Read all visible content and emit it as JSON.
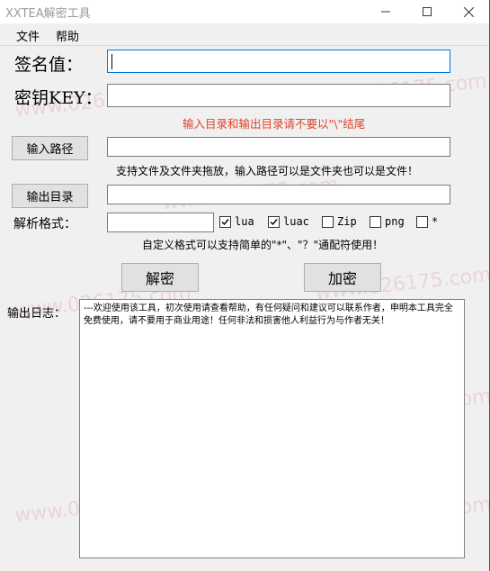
{
  "window": {
    "title": "XXTEA解密工具",
    "controls": [
      "minimize",
      "maximize",
      "close"
    ]
  },
  "menu": [
    "文件",
    "帮助"
  ],
  "form": {
    "sign_label": "签名值：",
    "sign_value": "",
    "key_label": "密钥KEY：",
    "key_value": "",
    "dir_warning": "输入目录和输出目录请不要以\"\\\"结尾",
    "input_path_button": "输入路径",
    "input_path_value": "",
    "drag_hint": "支持文件及文件夹拖放，输入路径可以是文件夹也可以是文件！",
    "output_dir_button": "输出目录",
    "output_dir_value": "",
    "format_label": "解析格式：",
    "format_custom_value": "",
    "format_options": [
      {
        "label": "lua",
        "checked": true
      },
      {
        "label": "luac",
        "checked": true
      },
      {
        "label": "Zip",
        "checked": false
      },
      {
        "label": "png",
        "checked": false
      },
      {
        "label": "*",
        "checked": false
      }
    ],
    "wildcard_hint": "自定义格式可以支持简单的\"*\"、\"？\"通配符使用！",
    "decrypt_button": "解密",
    "encrypt_button": "加密"
  },
  "log": {
    "label": "输出日志：",
    "text": "---欢迎使用该工具，初次使用请查看帮助，有任何疑问和建议可以联系作者，申明本工具完全免费使用，请不要用于商业用途！任何非法和损害他人利益行为与作者无关！"
  },
  "watermark": "www.026175.com",
  "colors": {
    "accent": "#0078d7",
    "warning": "#e0442a",
    "window_bg": "#f0f0f0"
  }
}
